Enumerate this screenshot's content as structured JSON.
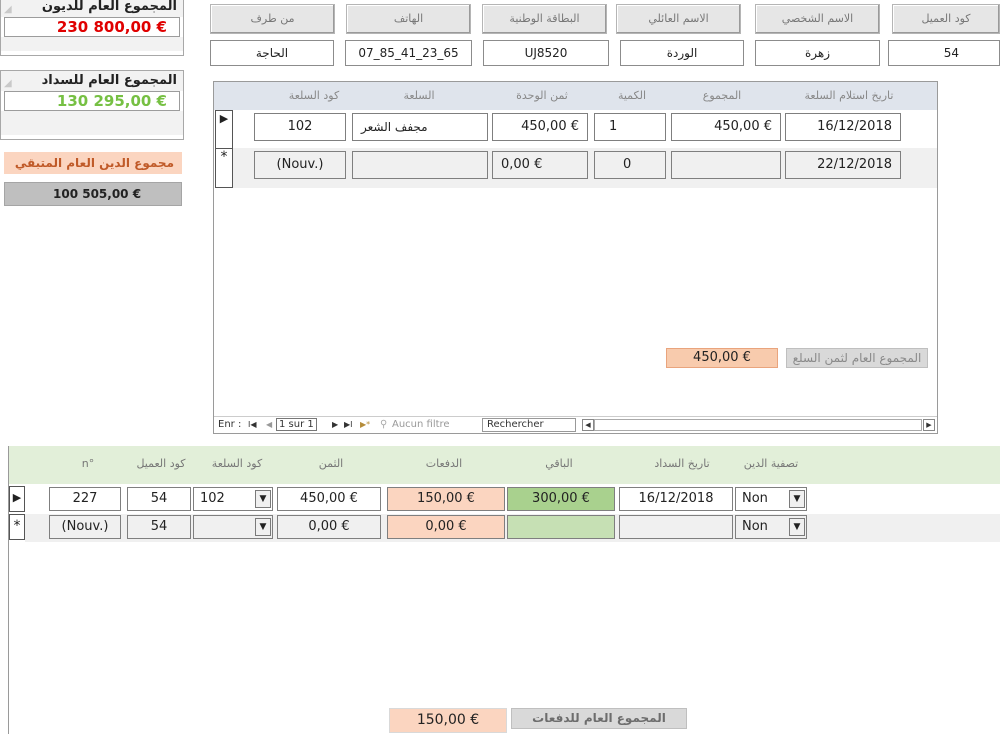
{
  "summary": {
    "debts_title": "المجموع العام للديون",
    "debts_value": "230 800,00 €",
    "payments_title": "المجموع العام للسداد",
    "payments_value": "130 295,00 €",
    "remaining_label": "مجموع الدين العام المتبقي",
    "remaining_value": "100 505,00 €"
  },
  "header": {
    "labels": {
      "customer_code": "كود العميل",
      "first_name": "الاسم الشخصي",
      "family_name": "الاسم العائلي",
      "national_id": "البطاقة الوطنية",
      "phone": "الهاتف",
      "by": "من طرف"
    },
    "values": {
      "customer_code": "54",
      "first_name": "زهرة",
      "family_name": "الوردة",
      "national_id": "UJ8520",
      "phone": "07_85_41_23_65",
      "by": "الحاجة"
    }
  },
  "goods": {
    "columns": {
      "date": "تاريخ استلام السلعة",
      "total": "المجموع",
      "qty": "الكمية",
      "unit_price": "ثمن الوحدة",
      "item": "السلعة",
      "item_code": "كود السلعة"
    },
    "rows": [
      {
        "selector": "▶",
        "item_code": "102",
        "item": "مجفف الشعر",
        "unit_price": "450,00 €",
        "qty": "1",
        "total": "450,00 €",
        "date": "16/12/2018"
      },
      {
        "selector": "*",
        "item_code": "(Nouv.)",
        "item": "",
        "unit_price": "0,00 €",
        "qty": "0",
        "total": "",
        "date": "22/12/2018"
      }
    ],
    "total_label": "المجموع العام لثمن السلع",
    "total_value": "450,00 €",
    "nav": {
      "record_prefix": "Enr :",
      "first": "I◀",
      "prev": "◀",
      "position": "1 sur 1",
      "next": "▶",
      "last": "▶I",
      "new": "▶*",
      "filter_icon": "⚲",
      "filter": "Aucun filtre",
      "search": "Rechercher",
      "scroll_left": "◀",
      "scroll_right": "▶"
    }
  },
  "payments": {
    "columns": {
      "n": "n°",
      "customer_code": "كود العميل",
      "item_code": "كود السلعة",
      "price": "الثمن",
      "payments": "الدفعات",
      "remaining": "الباقي",
      "pay_date": "تاريخ السداد",
      "settle": "تصفية الدين"
    },
    "rows": [
      {
        "selector": "▶",
        "n": "227",
        "customer_code": "54",
        "item_code": "102",
        "price": "450,00 €",
        "payments": "150,00 €",
        "remaining": "300,00 €",
        "pay_date": "16/12/2018",
        "settle": "Non"
      },
      {
        "selector": "*",
        "n": "(Nouv.)",
        "customer_code": "54",
        "item_code": "",
        "price": "0,00 €",
        "payments": "0,00 €",
        "remaining": "",
        "pay_date": "",
        "settle": "Non"
      }
    ],
    "total_label": "المجموع العام للدفعات",
    "total_value": "150,00 €"
  },
  "icons": {
    "dropdown": "▼"
  },
  "colors": {
    "debt_red": "#e00000",
    "payment_green": "#76c043",
    "peach": "#fbd5c0",
    "light_green": "#c6e0b4",
    "goods_header": "#dfe4ec",
    "payments_header": "#e2efd9"
  }
}
